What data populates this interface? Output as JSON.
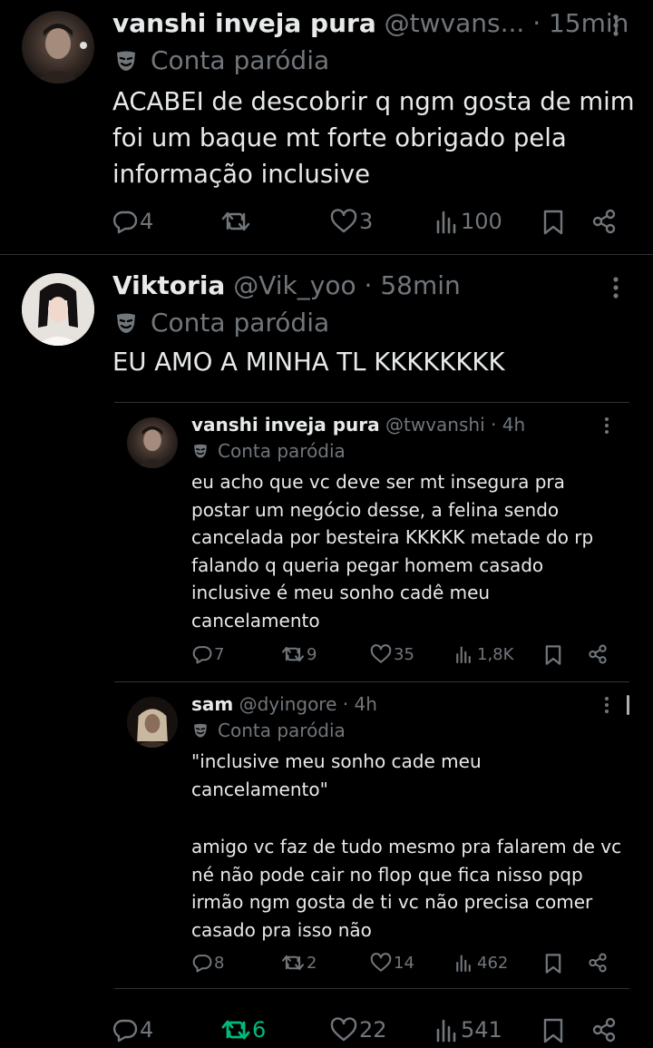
{
  "tweet1": {
    "name": "vanshi inveja pura",
    "handle": "@twvans...",
    "time": "· 15min",
    "parody_label": "Conta paródia",
    "text_lines": [
      "ACABEI de descobrir q ngm gosta de mim",
      "foi um baque mt forte obrigado pela",
      "informação inclusive"
    ],
    "replies": "4",
    "retweets": "",
    "likes": "3",
    "views": "100"
  },
  "tweet2": {
    "name": "Viktoria",
    "handle": "@Vik_yoo",
    "time": "· 58min",
    "parody_label": "Conta paródia",
    "text": "EU AMO A MINHA TL KKKKKKKK",
    "replies": "4",
    "retweets": "6",
    "likes": "22",
    "views": "541"
  },
  "quote1": {
    "name": "vanshi inveja pura",
    "handle": "@twvanshi",
    "time": "· 4h",
    "parody_label": "Conta paródia",
    "text_lines": [
      "eu acho que vc deve ser mt insegura pra",
      "postar um negócio desse, a felina sendo",
      "cancelada por besteira KKKKK metade do rp",
      "falando q queria pegar homem casado",
      "inclusive é meu sonho cadê meu",
      "cancelamento"
    ],
    "replies": "7",
    "retweets": "9",
    "likes": "35",
    "views": "1,8K"
  },
  "quote2": {
    "name": "sam",
    "handle": "@dyingore",
    "time": "· 4h",
    "parody_label": "Conta paródia",
    "text_lines": [
      "\"inclusive meu sonho cade meu",
      "cancelamento\"",
      "",
      "amigo vc faz de tudo mesmo pra falarem de vc",
      "né não pode cair no flop que fica nisso pqp",
      "irmão ngm gosta de ti vc não precisa comer",
      "casado pra isso não"
    ],
    "replies": "8",
    "retweets": "2",
    "likes": "14",
    "views": "462"
  },
  "colors": {
    "background": "#000000",
    "text": "#e7e9ea",
    "muted": "#71767b",
    "divider": "#2f3336",
    "retweet_active": "#00ba7c"
  },
  "icons": [
    "reply-icon",
    "retweet-icon",
    "like-icon",
    "views-icon",
    "bookmark-icon",
    "share-icon",
    "more-icon",
    "parody-mask-icon"
  ]
}
